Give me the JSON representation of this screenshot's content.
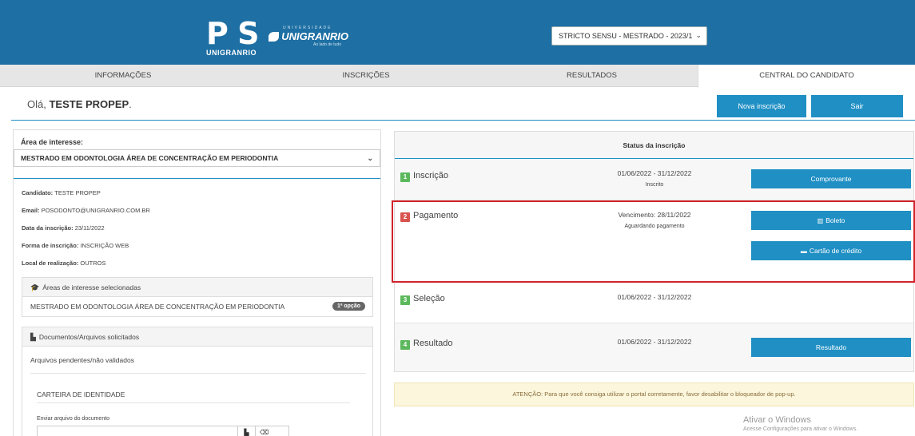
{
  "header": {
    "logo_pos_text": "P S",
    "logo_pos_sub": "UNIGRANRIO",
    "logo_uni_tiny": "UNIVERSIDADE",
    "logo_uni_name": "UNIGRANRIO",
    "logo_uni_slogan": "Ao lado de tudo",
    "program_select": "STRICTO SENSU - MESTRADO - 2023/1"
  },
  "nav": {
    "items": [
      {
        "label": "INFORMAÇÕES"
      },
      {
        "label": "INSCRIÇÕES"
      },
      {
        "label": "RESULTADOS"
      },
      {
        "label": "CENTRAL DO CANDIDATO"
      }
    ]
  },
  "greeting": {
    "prefix": "Olá, ",
    "name": "TESTE PROPEP",
    "suffix": "."
  },
  "top_buttons": {
    "new": "Nova inscrição",
    "exit": "Sair"
  },
  "left": {
    "area_label": "Área de interesse:",
    "area_value": "MESTRADO EM ODONTOLOGIA ÁREA DE CONCENTRAÇÃO EM PERIODONTIA",
    "info": [
      {
        "key": "Candidato: ",
        "value": "TESTE PROPEP"
      },
      {
        "key": "Email: ",
        "value": "POSODONTO@UNIGRANRIO.COM.BR"
      },
      {
        "key": "Data da inscrição: ",
        "value": "23/11/2022"
      },
      {
        "key": "Forma de inscrição: ",
        "value": "INSCRIÇÃO WEB"
      },
      {
        "key": "Local de realização: ",
        "value": "OUTROS"
      }
    ],
    "interests_title": "Áreas de interesse selecionadas",
    "interest_item": "MESTRADO EM ODONTOLOGIA ÁREA DE CONCENTRAÇÃO EM PERIODONTIA",
    "interest_badge": "1ª opção",
    "docs_title": "Documentos/Arquivos solicitados",
    "docs_pending": "Arquivos pendentes/não validados",
    "doc_name": "CARTEIRA DE IDENTIDADE",
    "doc_send": "Enviar arquivo do documento"
  },
  "right": {
    "status_title": "Status da inscrição",
    "steps": [
      {
        "num": "1",
        "name": "Inscrição",
        "date": "01/06/2022 - 31/12/2022",
        "state": "Inscrito",
        "button": "Comprovante"
      },
      {
        "num": "2",
        "name": "Pagamento",
        "date": "Vencimento: 28/11/2022",
        "state": "Aguardando pagamento",
        "button": "Boleto",
        "button2": "Cartão de crédito"
      },
      {
        "num": "3",
        "name": "Seleção",
        "date": "01/06/2022 - 31/12/2022"
      },
      {
        "num": "4",
        "name": "Resultado",
        "date": "01/06/2022 - 31/12/2022",
        "button": "Resultado"
      }
    ]
  },
  "alert": "ATENÇÃO: Para que você consiga utilizar o portal corretamente, favor desabilitar o bloqueador de pop-up.",
  "windows_watermark": {
    "title": "Ativar o Windows",
    "subtitle": "Acesse Configurações para ativar o Windows."
  },
  "colors": {
    "header": "#1e6fa3",
    "primary_button": "#1f8fc4",
    "highlight": "#d0232a",
    "step_green": "#5cb85c",
    "step_red": "#d9534f"
  }
}
